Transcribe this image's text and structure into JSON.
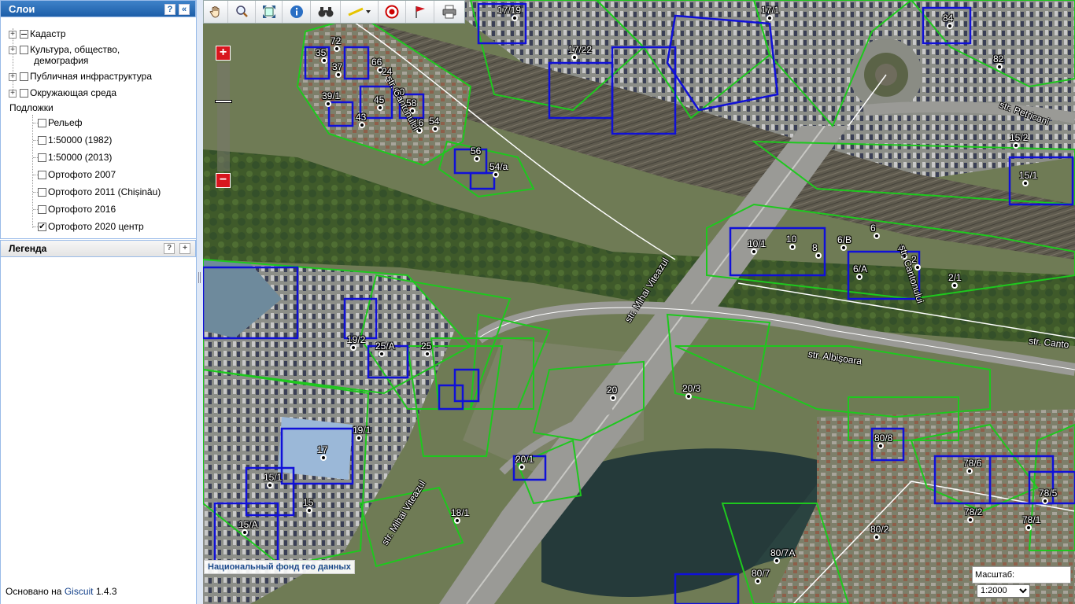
{
  "layers_panel": {
    "title": "Слои",
    "help_label": "?",
    "collapse_label": "«",
    "groups": [
      {
        "label": "Кадастр"
      },
      {
        "label": "Культура, общество,"
      },
      {
        "label": "демография"
      },
      {
        "label": "Публичная инфраструктура"
      },
      {
        "label": "Окружающая среда"
      }
    ],
    "basemaps_title": "Подложки",
    "basemaps": [
      {
        "label": "Рельеф",
        "checked": false
      },
      {
        "label": "1:50000 (1982)",
        "checked": false
      },
      {
        "label": "1:50000 (2013)",
        "checked": false
      },
      {
        "label": "Ортофото 2007",
        "checked": false
      },
      {
        "label": "Ортофото 2011 (Chișinău)",
        "checked": false
      },
      {
        "label": "Ортофото 2016",
        "checked": false
      },
      {
        "label": "Ортофото 2020 центр",
        "checked": true
      }
    ],
    "checkmark": "✔"
  },
  "legend_panel": {
    "title": "Легенда",
    "help_label": "?",
    "expand_label": "+"
  },
  "footer": {
    "prefix": "Основано на",
    "link": "Giscuit",
    "version": "1.4.3"
  },
  "map": {
    "zoom_in_label": "+",
    "zoom_out_label": "−",
    "attribution": "Национальный фонд гео данных",
    "scale_label": "Масштаб:",
    "scale_value": "1:2000",
    "colors": {
      "cadastre_outline": "#1ec81e",
      "building_outline": "#1010d8",
      "zoom_button": "#d8161e"
    },
    "streets": [
      {
        "text": "str. Cantonului"
      },
      {
        "text": "str. Petricani"
      },
      {
        "text": "str. Mihai Viteazul"
      },
      {
        "text": "str. Albișoara"
      },
      {
        "text": "str. Mihai Viteazul"
      },
      {
        "text": "str. Cantonului"
      },
      {
        "text": "str. Canto"
      }
    ],
    "parcels": [
      "17/19",
      "17/1",
      "84",
      "72",
      "35",
      "37",
      "66",
      "24",
      "30",
      "39/1",
      "45",
      "58",
      "43",
      "16",
      "54",
      "56",
      "54/a",
      "17/22",
      "82",
      "15/2",
      "15/1",
      "10/1",
      "10",
      "8",
      "6/B",
      "6",
      "4",
      "2",
      "6/A",
      "2/1",
      "19/2",
      "25/A",
      "25",
      "20",
      "20/3",
      "19/1",
      "17",
      "15/1",
      "15",
      "15/A",
      "18/1",
      "20/1",
      "80/8",
      "78/6",
      "78/5",
      "78/2",
      "78/1",
      "80/2",
      "80/7A",
      "80/7"
    ]
  },
  "toolbar": {
    "tools": [
      "hand-icon",
      "zoom-box-icon",
      "full-extent-icon",
      "info-icon",
      "binoculars-icon",
      "measure-icon",
      "target-icon",
      "flag-icon",
      "print-icon"
    ]
  }
}
